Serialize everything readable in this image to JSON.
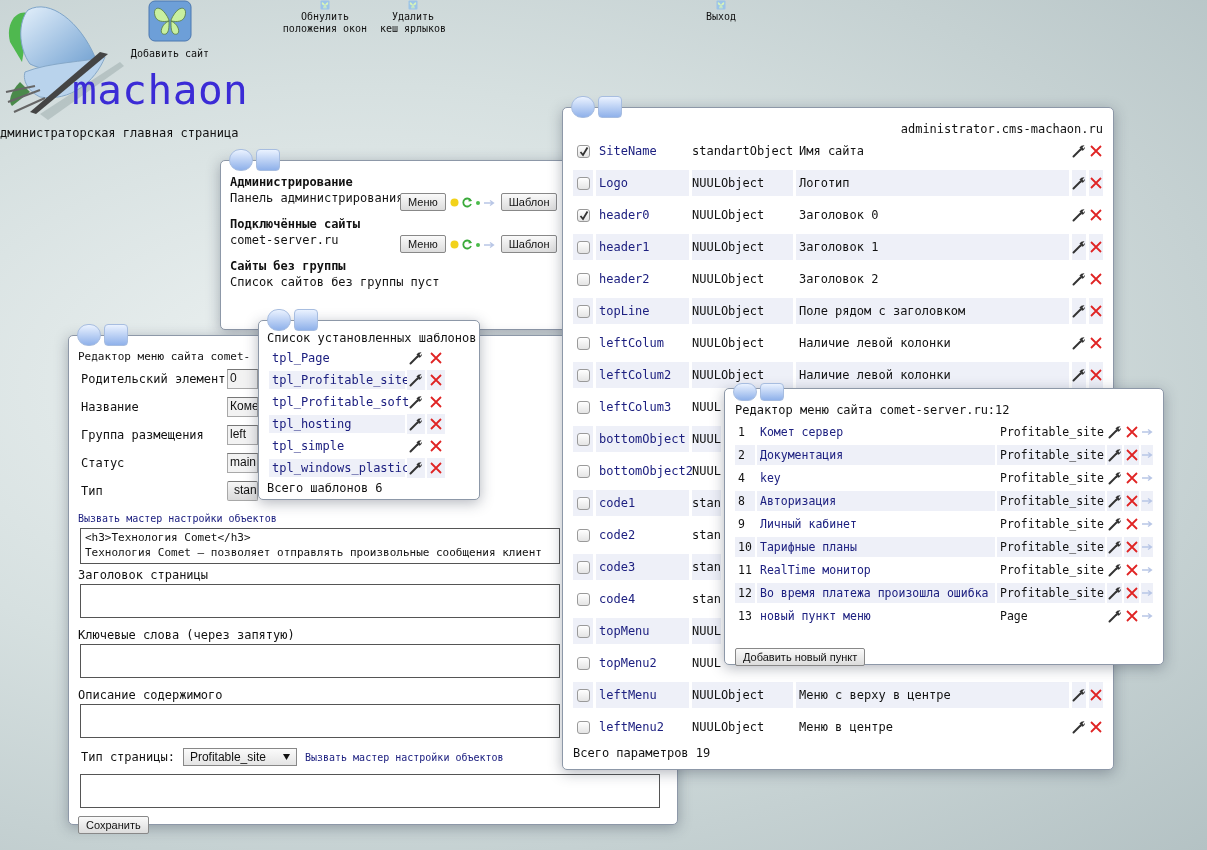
{
  "desktop_icons": [
    {
      "label": "Добавить сайт",
      "kind": "large"
    },
    {
      "label": "Обнулить\nположения окон",
      "kind": "small"
    },
    {
      "label": "Удалить\nкеш ярлыков",
      "kind": "small"
    },
    {
      "label": "Выход",
      "kind": "small"
    }
  ],
  "logo": {
    "text": "machaon"
  },
  "page_title": "дминистраторская главная страница",
  "sites_window": {
    "sections": [
      {
        "heading": "Администрирование",
        "sites": [
          {
            "name": "Панель администрирования",
            "menu_button": "Меню",
            "templates_button": "Шаблон"
          }
        ]
      },
      {
        "heading": "Подключённые сайты",
        "sites": [
          {
            "name": "comet-server.ru",
            "menu_button": "Меню",
            "templates_button": "Шаблон"
          }
        ]
      },
      {
        "heading": "Сайты без группы",
        "empty_text": "Список сайтов без группы пуст"
      }
    ]
  },
  "menu_editor": {
    "title": "Редактор меню сайта comet-",
    "fields": [
      {
        "label": "Родительский элемент",
        "value": "0",
        "kind": "input"
      },
      {
        "label": "Название",
        "value": "Коме",
        "kind": "input"
      },
      {
        "label": "Группа размещения",
        "value": "left",
        "kind": "input"
      },
      {
        "label": "Статус",
        "value": "main",
        "kind": "input"
      },
      {
        "label": "Тип",
        "value": "stan",
        "kind": "select"
      }
    ],
    "wizard_link": "Вызвать мастер настройки объектов",
    "content": "<h3>Технология Comet</h3>\nТехнология Comet — позволяет отправлять произвольные сообщения клиент",
    "text_fields": [
      {
        "label": "Заголовок страницы"
      },
      {
        "label": "Ключевые слова (через запятую)"
      },
      {
        "label": "Описание содержимого"
      }
    ],
    "page_type": {
      "label": "Тип страницы:",
      "value": "Profitable_site",
      "link": "Вызвать мастер настройки объектов"
    },
    "save_button": "Сохранить"
  },
  "templates_window": {
    "title": "Список установленных шаблонов",
    "templates": [
      "tpl_Page",
      "tpl_Profitable_site",
      "tpl_Profitable_soft",
      "tpl_hosting",
      "tpl_simple",
      "tpl_windows_plastic"
    ],
    "total": "Всего шаблонов 6"
  },
  "params_window": {
    "host": "administrator.cms-machaon.ru",
    "rows": [
      {
        "name": "SiteName",
        "type": "standartObject",
        "description": "Имя сайта",
        "checked": true
      },
      {
        "name": "Logo",
        "type": "NUULObject",
        "description": "Логотип",
        "checked": false
      },
      {
        "name": "header0",
        "type": "NUULObject",
        "description": "Заголовок 0",
        "checked": true
      },
      {
        "name": "header1",
        "type": "NUULObject",
        "description": "Заголовок 1",
        "checked": false
      },
      {
        "name": "header2",
        "type": "NUULObject",
        "description": "Заголовок 2",
        "checked": false
      },
      {
        "name": "topLine",
        "type": "NUULObject",
        "description": "Поле рядом с заголовком",
        "checked": false
      },
      {
        "name": "leftColum",
        "type": "NUULObject",
        "description": "Наличие левой колонки",
        "checked": false
      },
      {
        "name": "leftColum2",
        "type": "NUULObject",
        "description": "Наличие левой колонки",
        "checked": false
      },
      {
        "name": "leftColum3",
        "type": "NUUL",
        "checked": false
      },
      {
        "name": "bottomObject",
        "type": "NUUL",
        "checked": false
      },
      {
        "name": "bottomObject2",
        "type": "NUUL",
        "checked": false
      },
      {
        "name": "code1",
        "type": "stan",
        "checked": false
      },
      {
        "name": "code2",
        "type": "stan",
        "checked": false
      },
      {
        "name": "code3",
        "type": "stan",
        "checked": false
      },
      {
        "name": "code4",
        "type": "stan",
        "checked": false
      },
      {
        "name": "topMenu",
        "type": "NUUL",
        "checked": false
      },
      {
        "name": "topMenu2",
        "type": "NUUL",
        "checked": false
      },
      {
        "name": "leftMenu",
        "type": "NUULObject",
        "description": "Меню с верху в центре",
        "checked": false
      },
      {
        "name": "leftMenu2",
        "type": "NUULObject",
        "description": "Меню в центре",
        "checked": false
      }
    ],
    "total": "Всего параметров 19"
  },
  "menu_items_window": {
    "title": "Редактор меню сайта comet-server.ru:12",
    "items": [
      {
        "number": "1",
        "name": "Комет сервер",
        "template": "Profitable_site"
      },
      {
        "number": "2",
        "name": "Документация",
        "template": "Profitable_site"
      },
      {
        "number": "4",
        "name": "key",
        "template": "Profitable_site"
      },
      {
        "number": "8",
        "name": "Авторизация",
        "template": "Profitable_site"
      },
      {
        "number": "9",
        "name": "Личный кабинет",
        "template": "Profitable_site"
      },
      {
        "number": "10",
        "name": "Тарифные планы",
        "template": "Profitable_site"
      },
      {
        "number": "11",
        "name": "RealTime монитор",
        "template": "Profitable_site"
      },
      {
        "number": "12",
        "name": "Во время платежа произошла ошибка",
        "template": "Profitable_site"
      },
      {
        "number": "13",
        "name": "новый пункт меню",
        "template": "Page"
      }
    ],
    "add_button": "Добавить новый пункт"
  }
}
